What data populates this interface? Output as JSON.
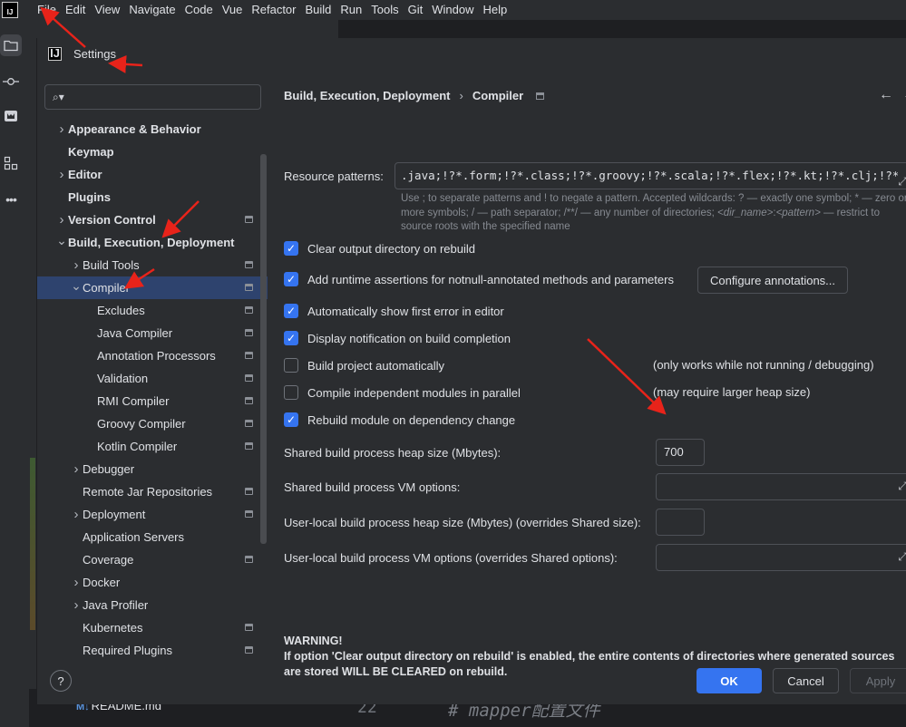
{
  "ide": {
    "logo_text": "IJ",
    "menu": [
      "File",
      "Edit",
      "View",
      "Navigate",
      "Code",
      "Vue",
      "Refactor",
      "Build",
      "Run",
      "Tools",
      "Git",
      "Window",
      "Help"
    ]
  },
  "editor": {
    "readme_badge": "M↓",
    "readme_file": "README.md",
    "line_number": "22",
    "code_comment": "# mapper配置文件"
  },
  "dialog": {
    "title": "Settings",
    "search_placeholder": "",
    "tree": [
      {
        "label": "Appearance & Behavior",
        "bold": true,
        "chevron": "right"
      },
      {
        "label": "Keymap",
        "bold": true
      },
      {
        "label": "Editor",
        "bold": true,
        "chevron": "right"
      },
      {
        "label": "Plugins",
        "bold": true
      },
      {
        "label": "Version Control",
        "bold": true,
        "chevron": "right",
        "page_icon": true
      },
      {
        "label": "Build, Execution, Deployment",
        "bold": true,
        "chevron": "down"
      },
      {
        "label": "Build Tools",
        "chevron": "right",
        "page_icon": true
      },
      {
        "label": "Compiler",
        "chevron": "down",
        "page_icon": true,
        "selected": true
      },
      {
        "label": "Excludes",
        "page_icon": true
      },
      {
        "label": "Java Compiler",
        "page_icon": true
      },
      {
        "label": "Annotation Processors",
        "page_icon": true
      },
      {
        "label": "Validation",
        "page_icon": true
      },
      {
        "label": "RMI Compiler",
        "page_icon": true
      },
      {
        "label": "Groovy Compiler",
        "page_icon": true
      },
      {
        "label": "Kotlin Compiler",
        "page_icon": true
      },
      {
        "label": "Debugger",
        "chevron": "right"
      },
      {
        "label": "Remote Jar Repositories",
        "page_icon": true
      },
      {
        "label": "Deployment",
        "chevron": "right",
        "page_icon": true
      },
      {
        "label": "Application Servers"
      },
      {
        "label": "Coverage",
        "page_icon": true
      },
      {
        "label": "Docker",
        "chevron": "right"
      },
      {
        "label": "Java Profiler",
        "chevron": "right"
      },
      {
        "label": "Kubernetes",
        "page_icon": true
      },
      {
        "label": "Required Plugins",
        "page_icon": true
      }
    ],
    "breadcrumb": {
      "parent": "Build, Execution, Deployment",
      "separator": "›",
      "current": "Compiler"
    },
    "resource_patterns": {
      "label": "Resource patterns:",
      "value": ".java;!?*.form;!?*.class;!?*.groovy;!?*.scala;!?*.flex;!?*.kt;!?*.clj;!?*.aj",
      "hint_1": "Use ; to separate patterns and ! to negate a pattern. Accepted wildcards: ? — exactly one symbol; * — zero or more symbols; / — path separator; /**/ — any number of directories; ",
      "hint_dir": "<dir_name>",
      "hint_colon": ":",
      "hint_pattern": "<pattern>",
      "hint_2": " — restrict to source roots with the specified name"
    },
    "options": [
      {
        "label": "Clear output directory on rebuild",
        "checked": true
      },
      {
        "label": "Add runtime assertions for notnull-annotated methods and parameters",
        "checked": true
      },
      {
        "label": "Automatically show first error in editor",
        "checked": true
      },
      {
        "label": "Display notification on build completion",
        "checked": true
      },
      {
        "label": "Build project automatically",
        "checked": false,
        "note": "(only works while not running / debugging)"
      },
      {
        "label": "Compile independent modules in parallel",
        "checked": false,
        "note": "(may require larger heap size)"
      },
      {
        "label": "Rebuild module on dependency change",
        "checked": true
      }
    ],
    "configure_annotations": "Configure annotations...",
    "heap_size": {
      "label": "Shared build process heap size (Mbytes):",
      "value": "700"
    },
    "vm_options": {
      "label": "Shared build process VM options:",
      "value": ""
    },
    "local_heap": {
      "label": "User-local build process heap size (Mbytes) (overrides Shared size):",
      "value": ""
    },
    "local_vm": {
      "label": "User-local build process VM options (overrides Shared options):",
      "value": ""
    },
    "warning_title": "WARNING!",
    "warning_text": "If option 'Clear output directory on rebuild' is enabled, the entire contents of directories where generated sources are stored WILL BE CLEARED on rebuild.",
    "buttons": {
      "help": "?",
      "ok": "OK",
      "cancel": "Cancel",
      "apply": "Apply"
    }
  },
  "colors": {
    "background": "#2b2d30",
    "editor_background": "#1e1f22",
    "accent": "#3574f0",
    "selection": "#2e436e",
    "annotation_arrow": "#e8231a"
  }
}
